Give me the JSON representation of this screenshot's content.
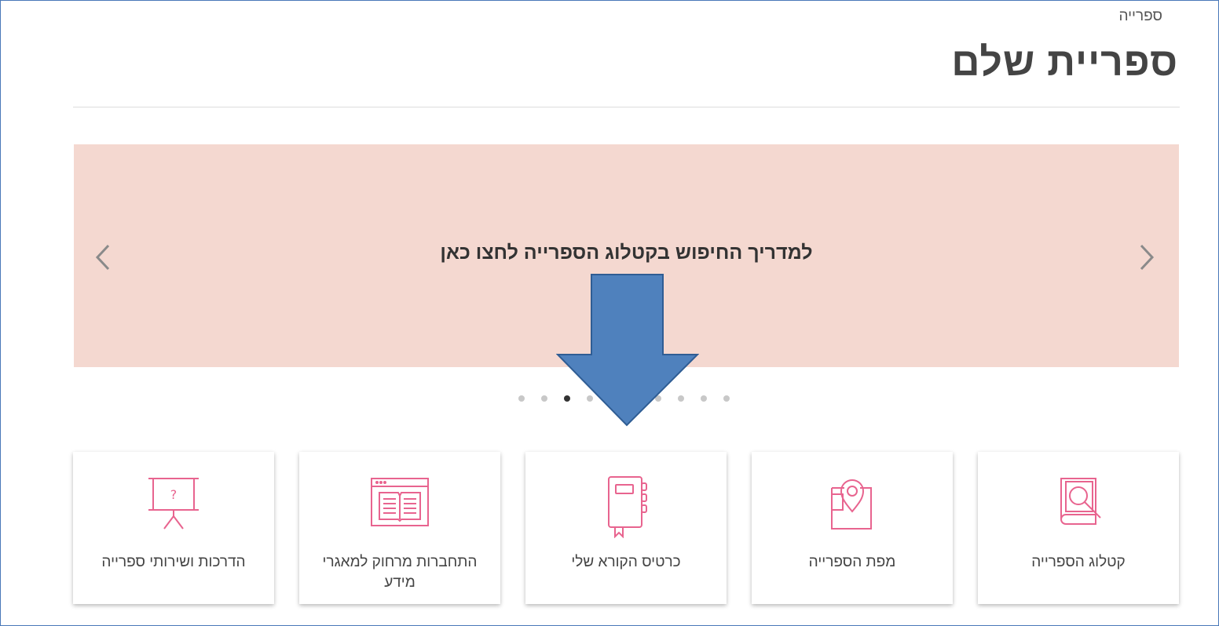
{
  "breadcrumb": "ספרייה",
  "page_title": "ספריית שלם",
  "banner": {
    "text": "למדריך החיפוש בקטלוג הספרייה לחצו כאן",
    "prev_icon": "chevron-left-icon",
    "next_icon": "chevron-right-icon"
  },
  "carousel": {
    "dot_count": 10,
    "active_index": 2
  },
  "colors": {
    "banner_bg": "#f4d8d0",
    "icon_accent": "#e8648f",
    "annotation_arrow_fill": "#4f81bd",
    "annotation_arrow_stroke": "#2f5d94"
  },
  "tiles": [
    {
      "label": "קטלוג הספרייה",
      "icon": "book-search-icon"
    },
    {
      "label": "מפת הספרייה",
      "icon": "map-pin-icon"
    },
    {
      "label": "כרטיס הקורא שלי",
      "icon": "notebook-icon"
    },
    {
      "label": "התחברות מרחוק למאגרי מידע",
      "icon": "browser-book-icon"
    },
    {
      "label": "הדרכות ושירותי ספרייה",
      "icon": "presentation-board-icon"
    }
  ]
}
